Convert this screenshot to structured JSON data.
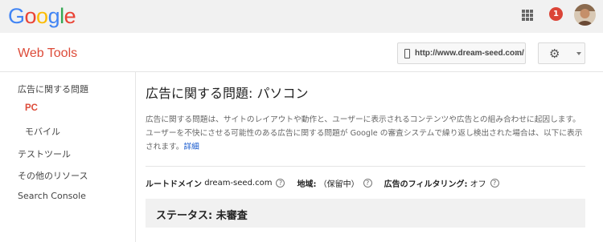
{
  "topbar": {
    "logo_letters": [
      {
        "ch": "G",
        "color": "#4285f4"
      },
      {
        "ch": "o",
        "color": "#ea4335"
      },
      {
        "ch": "o",
        "color": "#fbbc05"
      },
      {
        "ch": "g",
        "color": "#4285f4"
      },
      {
        "ch": "l",
        "color": "#34a853"
      },
      {
        "ch": "e",
        "color": "#ea4335"
      }
    ],
    "apps_icon": "apps-grid-icon",
    "notification_count": "1",
    "notification_color": "#db4437",
    "avatar_icon": "user-avatar"
  },
  "header": {
    "title": "Web Tools",
    "title_color": "#dd4b39",
    "site_url": "http://www.dream-seed.com/",
    "site_icon": "mobile-icon",
    "settings_icon": "gear-icon"
  },
  "sidebar": {
    "items": [
      {
        "label": "広告に関する問題",
        "active": false
      },
      {
        "label": "PC",
        "active": true
      },
      {
        "label": "モバイル",
        "active": false
      },
      {
        "label": "テストツール",
        "active": false
      },
      {
        "label": "その他のリソース",
        "active": false
      },
      {
        "label": "Search Console",
        "active": false
      }
    ]
  },
  "main": {
    "title": "広告に関する問題: パソコン",
    "description": "広告に関する問題は、サイトのレイアウトや動作と、ユーザーに表示されるコンテンツや広告との組み合わせに起因します。ユーザーを不快にさせる可能性のある広告に関する問題が Google の審査システムで繰り返し検出された場合は、以下に表示されます。",
    "details_link": "詳細",
    "info": {
      "root_domain_label": "ルートドメイン",
      "root_domain_value": "dream-seed.com",
      "region_label": "地域:",
      "region_value": "（保留中）",
      "filtering_label": "広告のフィルタリング:",
      "filtering_value": "オフ"
    },
    "status": "ステータス: 未審査"
  }
}
